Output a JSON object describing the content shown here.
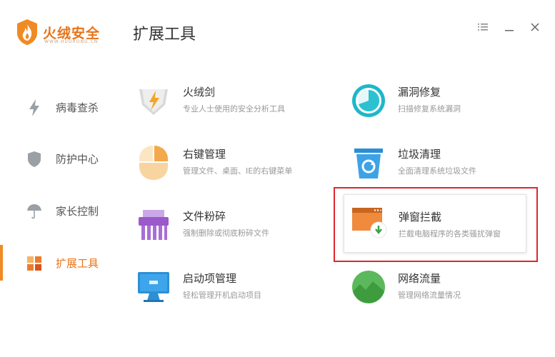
{
  "app": {
    "brand_name": "火绒安全",
    "brand_sub": "WWW.HUORONG.CN"
  },
  "header": {
    "title": "扩展工具"
  },
  "window_controls": [
    "menu-icon",
    "minimize-icon",
    "close-icon"
  ],
  "sidebar": {
    "items": [
      {
        "label": "病毒查杀",
        "icon": "lightning-icon",
        "active": false
      },
      {
        "label": "防护中心",
        "icon": "shield-icon",
        "active": false
      },
      {
        "label": "家长控制",
        "icon": "umbrella-icon",
        "active": false
      },
      {
        "label": "扩展工具",
        "icon": "tools-grid-icon",
        "active": true
      }
    ]
  },
  "tools": [
    {
      "name": "火绒剑",
      "desc": "专业人士使用的安全分析工具",
      "icon": "sword-icon"
    },
    {
      "name": "漏洞修复",
      "desc": "扫描修复系统漏洞",
      "icon": "vulnerability-fix-icon"
    },
    {
      "name": "右键管理",
      "desc": "管理文件、桌面、IE的右键菜单",
      "icon": "right-click-icon"
    },
    {
      "name": "垃圾清理",
      "desc": "全面清理系统垃圾文件",
      "icon": "trash-clean-icon"
    },
    {
      "name": "文件粉碎",
      "desc": "强制删除或彻底粉碎文件",
      "icon": "shredder-icon"
    },
    {
      "name": "弹窗拦截",
      "desc": "拦截电脑程序的各类骚扰弹窗",
      "icon": "popup-block-icon"
    },
    {
      "name": "启动项管理",
      "desc": "轻松管理开机启动项目",
      "icon": "startup-icon"
    },
    {
      "name": "网络流量",
      "desc": "管理网络流量情况",
      "icon": "network-traffic-icon"
    }
  ],
  "colors": {
    "accent": "#f08a24",
    "highlight": "#d9282e"
  }
}
